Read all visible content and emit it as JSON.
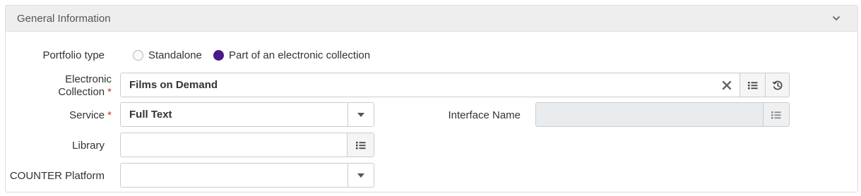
{
  "panel": {
    "title": "General Information",
    "icon": "chevron-down-icon"
  },
  "portfolio_type": {
    "label": "Portfolio type",
    "options": [
      {
        "label": "Standalone",
        "selected": false
      },
      {
        "label": "Part of an electronic collection",
        "selected": true
      }
    ],
    "accent": "#4b1a86"
  },
  "electronic_collection": {
    "label_line1": "Electronic",
    "label_line2": "Collection",
    "required_mark": "*",
    "value": "Films on Demand",
    "icons": [
      "close-icon",
      "list-icon",
      "history-icon"
    ]
  },
  "service": {
    "label": "Service",
    "required_mark": "*",
    "value": "Full Text",
    "icon": "caret-down-icon"
  },
  "interface_name": {
    "label": "Interface Name",
    "value": "",
    "icon": "list-icon"
  },
  "library": {
    "label": "Library",
    "value": "",
    "icon": "list-icon"
  },
  "counter_platform": {
    "label": "COUNTER Platform",
    "value": "",
    "icon": "caret-down-icon"
  },
  "colors": {
    "required": "#c0392b",
    "header_bg": "#eeeeee",
    "border": "#cccccc"
  }
}
